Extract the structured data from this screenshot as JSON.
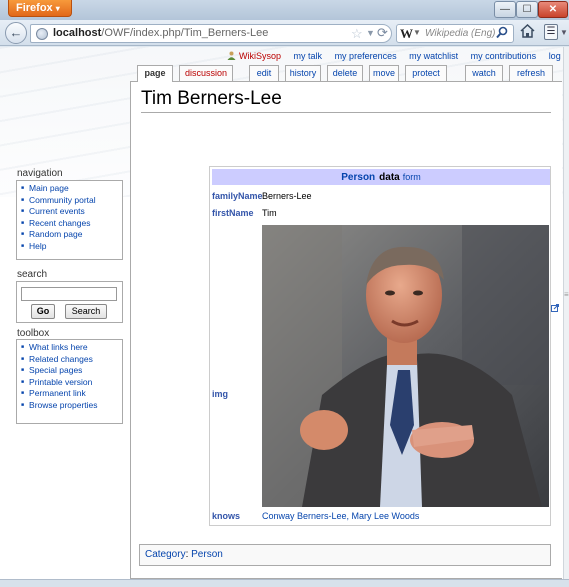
{
  "browser": {
    "menu_button_label": "Firefox",
    "menu_button_arrow": "▾",
    "window_buttons": {
      "minimize": "—",
      "maximize": "☐",
      "close": "✕"
    },
    "back_icon": "arrow-left-icon",
    "url_host": "localhost",
    "url_path": "/OWF/index.php/Tim_Berners-Lee",
    "search_engine_letter": "W",
    "search_engine_name": "Wikipedia (Eng)",
    "icons": [
      "globe-icon",
      "star-icon",
      "reload-icon",
      "search-icon",
      "home-icon",
      "bookmarks-icon"
    ]
  },
  "personal": {
    "user": "WikiSysop",
    "links": [
      "my talk",
      "my preferences",
      "my watchlist",
      "my contributions",
      "log out"
    ]
  },
  "tabs": [
    {
      "label": "page",
      "selected": true
    },
    {
      "label": "discussion",
      "selected": false,
      "new": true
    },
    {
      "label": "edit",
      "selected": false
    },
    {
      "label": "history",
      "selected": false
    },
    {
      "label": "delete",
      "selected": false
    },
    {
      "label": "move",
      "selected": false
    },
    {
      "label": "protect",
      "selected": false
    },
    {
      "label": "watch",
      "selected": false
    },
    {
      "label": "refresh",
      "selected": false
    }
  ],
  "page": {
    "title": "Tim Berners-Lee",
    "infobox": {
      "class_name": "Person",
      "data_word": "data",
      "form_link": "form",
      "rows": {
        "familyName": {
          "label": "familyName",
          "value": "Berners-Lee"
        },
        "firstName": {
          "label": "firstName",
          "value": "Tim"
        },
        "img": {
          "label": "img"
        },
        "knows": {
          "label": "knows",
          "value": "Conway Berners-Lee, Mary Lee Woods"
        }
      }
    },
    "category_label": "Category",
    "category_sep": ":",
    "category_value": "Person"
  },
  "sidebar": {
    "navigation": {
      "heading": "navigation",
      "items": [
        "Main page",
        "Community portal",
        "Current events",
        "Recent changes",
        "Random page",
        "Help"
      ]
    },
    "search": {
      "heading": "search",
      "go_label": "Go",
      "search_label": "Search",
      "query": ""
    },
    "toolbox": {
      "heading": "toolbox",
      "items": [
        "What links here",
        "Related changes",
        "Special pages",
        "Printable version",
        "Permanent link",
        "Browse properties"
      ]
    }
  },
  "colors": {
    "link": "#0645ad",
    "new_link": "#ba0000",
    "infobox_header": "#ccccff",
    "firefox_orange": "#e2681a"
  }
}
